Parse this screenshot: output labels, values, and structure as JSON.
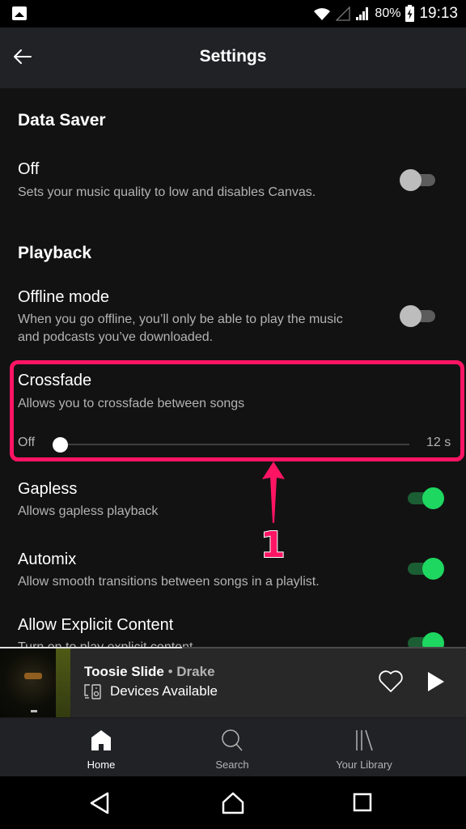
{
  "status_bar": {
    "notification_icon": "image-icon",
    "wifi_icon": "wifi-icon",
    "no_signal_icon": "no-signal-icon",
    "signal_icon": "cell-signal-icon",
    "battery_percent": "80%",
    "battery_icon": "battery-charging-icon",
    "time": "19:13"
  },
  "header": {
    "back_icon": "arrow-left-icon",
    "title": "Settings"
  },
  "sections": {
    "data_saver": {
      "title": "Data Saver",
      "items": [
        {
          "title": "Off",
          "description": "Sets your music quality to low and disables Canvas.",
          "toggle": false
        }
      ]
    },
    "playback": {
      "title": "Playback",
      "offline_mode": {
        "title": "Offline mode",
        "description_line1": "When you go offline, you’ll only be able to play the music",
        "description_line2": "and podcasts you’ve downloaded.",
        "toggle": false
      },
      "crossfade": {
        "title": "Crossfade",
        "description": "Allows you to crossfade between songs",
        "min_label": "Off",
        "max_label": "12 s",
        "value_seconds": 0,
        "max_seconds": 12
      },
      "gapless": {
        "title": "Gapless",
        "description": "Allows gapless playback",
        "toggle": true
      },
      "automix": {
        "title": "Automix",
        "description": "Allow smooth transitions between songs in a playlist.",
        "toggle": true
      },
      "explicit": {
        "title": "Allow Explicit Content",
        "description": "Turn on to play explicit content",
        "toggle": true
      }
    }
  },
  "annotation": {
    "step_number": "1",
    "color": "#ff1464"
  },
  "mini_player": {
    "track": "Toosie Slide",
    "separator": " • ",
    "artist": "Drake",
    "devices_label": "Devices Available",
    "devices_icon": "devices-icon",
    "heart_icon": "heart-outline-icon",
    "play_icon": "play-icon",
    "progress_fraction": 0.39
  },
  "bottom_nav": {
    "items": [
      {
        "label": "Home",
        "icon": "home-icon",
        "active": true
      },
      {
        "label": "Search",
        "icon": "search-icon",
        "active": false
      },
      {
        "label": "Your Library",
        "icon": "library-icon",
        "active": false
      }
    ]
  },
  "system_nav": {
    "back": "nav-back-icon",
    "home": "nav-home-icon",
    "recents": "nav-recents-icon"
  },
  "colors": {
    "accent_green": "#1ed760",
    "background": "#121212",
    "header_bg": "#212226",
    "annotation_pink": "#ff1464"
  }
}
